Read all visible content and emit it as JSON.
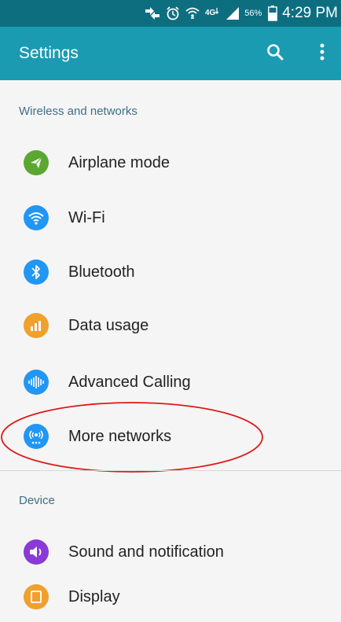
{
  "status_bar": {
    "battery_percent": "56%",
    "time": "4:29 PM",
    "icons": [
      "sync-icon",
      "alarm-icon",
      "wifi-calling-icon",
      "lte-icon",
      "signal-icon",
      "battery-icon"
    ]
  },
  "app_bar": {
    "title": "Settings",
    "actions": [
      "search-icon",
      "more-options-icon"
    ]
  },
  "sections": [
    {
      "header": "Wireless and networks",
      "items": [
        {
          "label": "Airplane mode",
          "icon": "airplane-icon",
          "color": "#5aa832"
        },
        {
          "label": "Wi-Fi",
          "icon": "wifi-icon",
          "color": "#2196f3"
        },
        {
          "label": "Bluetooth",
          "icon": "bluetooth-icon",
          "color": "#2196f3"
        },
        {
          "label": "Data usage",
          "icon": "data-usage-icon",
          "color": "#f0a02c"
        },
        {
          "label": "Advanced Calling",
          "icon": "advanced-calling-icon",
          "color": "#2196f3"
        },
        {
          "label": "More networks",
          "icon": "more-networks-icon",
          "color": "#2196f3"
        }
      ]
    },
    {
      "header": "Device",
      "items": [
        {
          "label": "Sound and notification",
          "icon": "sound-icon",
          "color": "#8a3ad6"
        },
        {
          "label": "Display",
          "icon": "display-icon",
          "color": "#f0a02c"
        }
      ]
    }
  ],
  "colors": {
    "status_bar": "#0d6e80",
    "app_bar": "#1a9bb2",
    "section_header": "#3d6f87",
    "annotation": "#e01818"
  }
}
